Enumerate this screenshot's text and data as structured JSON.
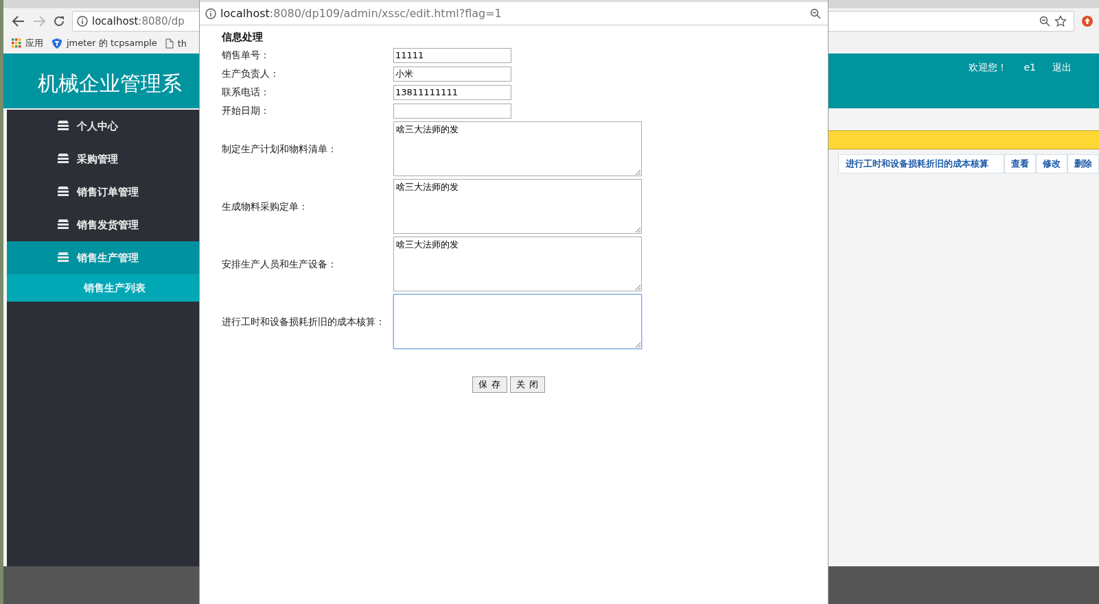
{
  "browser": {
    "address_host": "localhost",
    "address_rest": ":8080/dp",
    "bookmarks": [
      {
        "kind": "apps",
        "label": "应用"
      },
      {
        "kind": "shield",
        "label": "jmeter 的 tcpsample"
      },
      {
        "kind": "page",
        "label": "th"
      }
    ]
  },
  "header": {
    "title": "机械企业管理系",
    "welcome": "欢迎您！",
    "user": "e1",
    "logout": "退出"
  },
  "sidebar": {
    "items": [
      {
        "label": "个人中心",
        "selected": false
      },
      {
        "label": "采购管理",
        "selected": false
      },
      {
        "label": "销售订单管理",
        "selected": false
      },
      {
        "label": "销售发货管理",
        "selected": false
      },
      {
        "label": "销售生产管理",
        "selected": true,
        "children": [
          {
            "label": "销售生产列表"
          }
        ]
      }
    ]
  },
  "table": {
    "rows": [
      {
        "cell": "进行工时和设备损耗折旧的成本核算",
        "actions": [
          "查看",
          "修改",
          "删除"
        ]
      }
    ]
  },
  "popup": {
    "address_host": "localhost",
    "address_rest": ":8080/dp109/admin/xssc/edit.html?flag=1",
    "heading": "信息处理",
    "fields": [
      {
        "kind": "input",
        "label": "销售单号：",
        "value": "11111",
        "focused": false
      },
      {
        "kind": "input",
        "label": "生产负责人：",
        "value": "小米",
        "focused": false
      },
      {
        "kind": "input",
        "label": "联系电话：",
        "value": "13811111111",
        "focused": false
      },
      {
        "kind": "input",
        "label": "开始日期：",
        "focused": false
      },
      {
        "kind": "textarea",
        "label": "制定生产计划和物料清单：",
        "value": "啥三大法师的发",
        "focused": false
      },
      {
        "kind": "textarea",
        "label": "生成物料采购定单：",
        "value": "啥三大法师的发",
        "focused": false
      },
      {
        "kind": "textarea",
        "label": "安排生产人员和生产设备：",
        "value": "啥三大法师的发",
        "focused": false
      },
      {
        "kind": "textarea",
        "label": "进行工时和设备损耗折旧的成本核算：",
        "focused": true
      }
    ],
    "buttons": [
      "保 存",
      "关 闭"
    ]
  }
}
